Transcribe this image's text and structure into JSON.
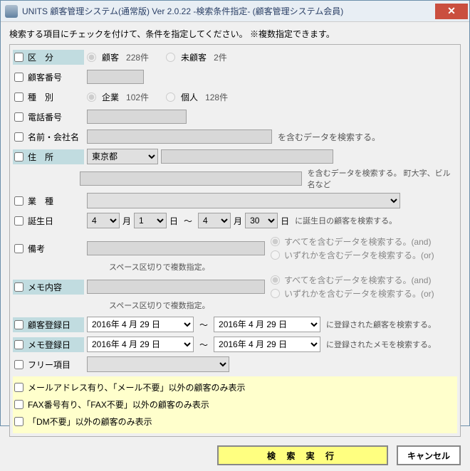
{
  "window": {
    "title": "UNITS 顧客管理システム(通常版)  Ver 2.0.22 -検索条件指定- (顧客管理システム会員)"
  },
  "instruction": "検索する項目にチェックを付けて、条件を指定してください。 ※複数指定できます。",
  "labels": {
    "kubun": "区　分",
    "customer_no": "顧客番号",
    "shubetsu": "種　別",
    "tel": "電話番号",
    "name": "名前・会社名",
    "address": "住　所",
    "gyoshu": "業　種",
    "birthday": "誕生日",
    "biko": "備考",
    "memo": "メモ内容",
    "cust_reg_date": "顧客登録日",
    "memo_reg_date": "メモ登録日",
    "free": "フリー項目"
  },
  "kubun": {
    "opt1": "顧客",
    "count1": "228件",
    "opt2": "未顧客",
    "count2": "2件"
  },
  "shubetsu": {
    "opt1": "企業",
    "count1": "102件",
    "opt2": "個人",
    "count2": "128件"
  },
  "name_hint": "を含むデータを検索する。",
  "address": {
    "pref": "東京都",
    "hint": "を含むデータを検索する。 町大字、ビル名など"
  },
  "birthday": {
    "m1": "4",
    "d1": "1",
    "m2": "4",
    "d2": "30",
    "month": "月",
    "day": "日",
    "sep": "～",
    "hint": "に誕生日の顧客を検索する。"
  },
  "helper_space": "スペース区切りで複数指定。",
  "logic": {
    "and": "すべてを含むデータを検索する。(and)",
    "or": "いずれかを含むデータを検索する。(or)"
  },
  "dates": {
    "d1": "2016年 4  月 29 日",
    "d2": "2016年 4  月 29 日",
    "d3": "2016年 4  月 29 日",
    "d4": "2016年 4  月 29 日",
    "sep": "～",
    "cust_hint": "に登録された顧客を検索する。",
    "memo_hint": "に登録されたメモを検索する。"
  },
  "yellow": {
    "mail": "メールアドレス有り、「メール不要」以外の顧客のみ表示",
    "fax": "FAX番号有り、「FAX不要」以外の顧客のみ表示",
    "dm": "「DM不要」以外の顧客のみ表示"
  },
  "buttons": {
    "search": "検 索 実 行",
    "cancel": "キャンセル"
  }
}
